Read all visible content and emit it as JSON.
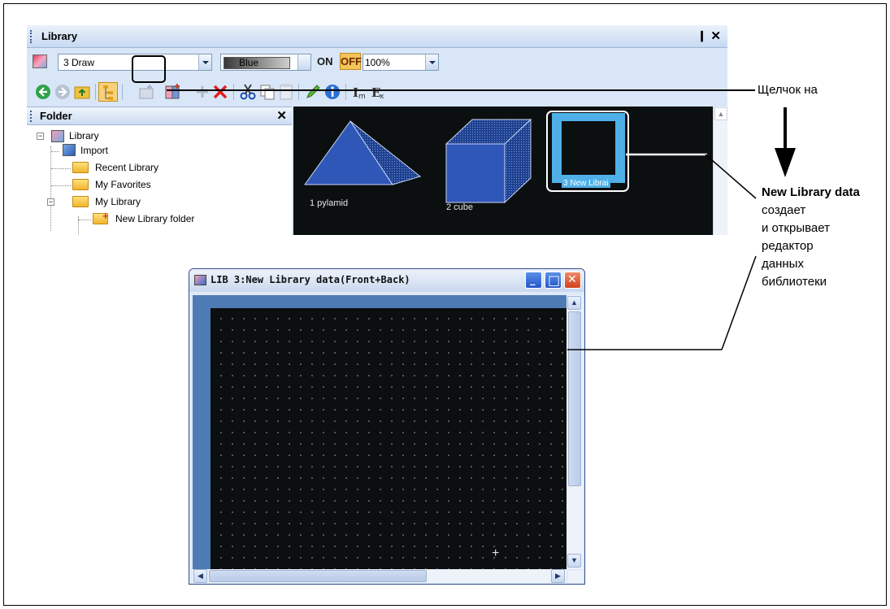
{
  "library_panel": {
    "title": "Library",
    "pin_glyph": "❙",
    "close_glyph": "✕",
    "library_combo_value": "3 Draw",
    "color_combo_value": "Blue",
    "on_label": "ON",
    "off_label": "OFF",
    "zoom_value": "100%",
    "toolbar_icons": [
      "back-icon",
      "forward-icon",
      "up-folder-icon",
      "folder-tree-icon",
      "new-folder-icon",
      "new-library-data-icon",
      "move-icon",
      "delete-icon",
      "cut-icon",
      "copy-icon",
      "paste-icon",
      "edit-icon",
      "info-icon",
      "import-icon",
      "export-icon"
    ]
  },
  "folder_pane": {
    "title": "Folder",
    "close_glyph": "✕",
    "items": [
      {
        "label": "Library",
        "expander": "−"
      },
      {
        "label": "Import"
      },
      {
        "label": "Recent Library"
      },
      {
        "label": "My Favorites"
      },
      {
        "label": "My Library",
        "expander": "−"
      },
      {
        "label": "New Library folder"
      }
    ]
  },
  "preview": {
    "items": [
      {
        "label": "1 pylamid"
      },
      {
        "label": "2 cube"
      },
      {
        "label": "3 New Librai"
      }
    ]
  },
  "editor": {
    "title": "LIB 3:New Library data(Front+Back)",
    "minimize_glyph": "_",
    "maximize_glyph": "□",
    "close_glyph": "✕"
  },
  "annotations": {
    "click_on": "Щелчок на",
    "desc_bold": "New Library data",
    "desc_rest_1": " создает",
    "desc_rest_2": "и открывает",
    "desc_rest_3": "редактор",
    "desc_rest_4": "данных",
    "desc_rest_5": "библиотеки"
  },
  "colors": {
    "panel_bg": "#d9e6f7",
    "preview_bg": "#0b0f10",
    "shape_blue": "#2f57b8",
    "selected_blue": "#4fb0e8",
    "off_orange": "#f3c45a"
  }
}
